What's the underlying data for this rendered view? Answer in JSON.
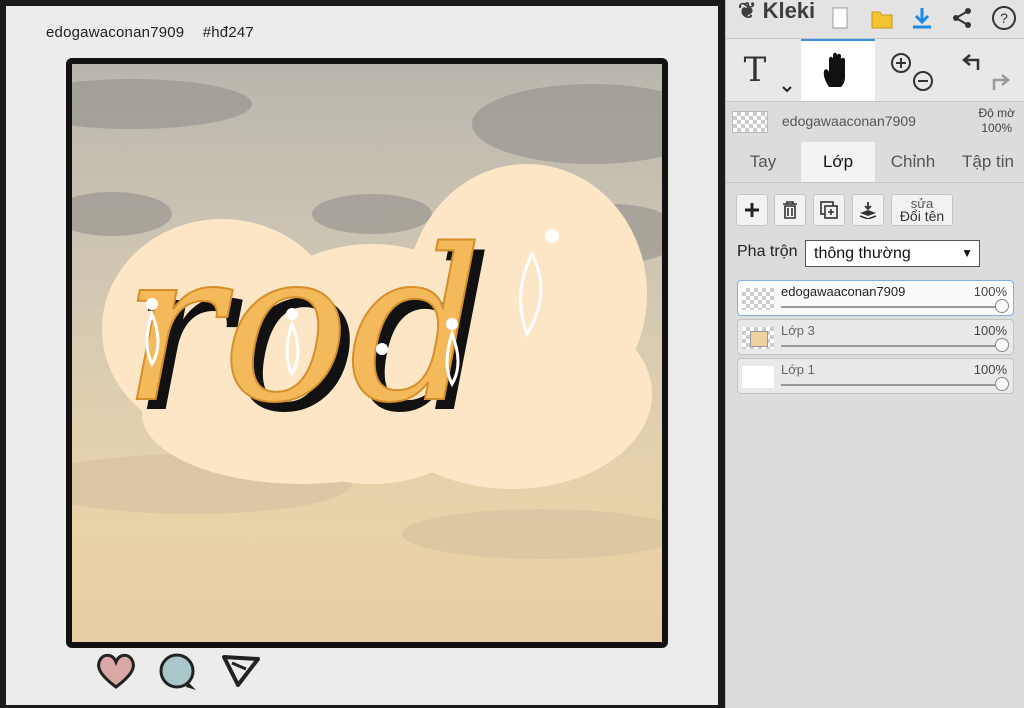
{
  "app": {
    "logo_text": "Kleki"
  },
  "post": {
    "username": "edogawaconan7909",
    "hashtag": "#hđ247",
    "artwork_text": "rod"
  },
  "panel": {
    "current_layer_name": "edogawaaconan7909",
    "opacity_label": "Độ mờ",
    "opacity_value": "100%",
    "tabs": [
      {
        "label": "Tay"
      },
      {
        "label": "Lớp"
      },
      {
        "label": "Chỉnh"
      },
      {
        "label": "Tập tin"
      }
    ],
    "active_tab": "Lớp",
    "rename_small": "sửa",
    "rename_label": "Đổi tên",
    "blend_label": "Pha trộn",
    "blend_value": "thông thường",
    "layers": [
      {
        "name": "edogawaaconan7909",
        "opacity": "100%",
        "active": true
      },
      {
        "name": "Lớp 3",
        "opacity": "100%",
        "active": false
      },
      {
        "name": "Lớp 1",
        "opacity": "100%",
        "active": false
      }
    ]
  },
  "colors": {
    "accent_blue": "#3a8fe0",
    "letter_fill": "#f3b95a",
    "sticker_bg": "#fde6c6"
  }
}
